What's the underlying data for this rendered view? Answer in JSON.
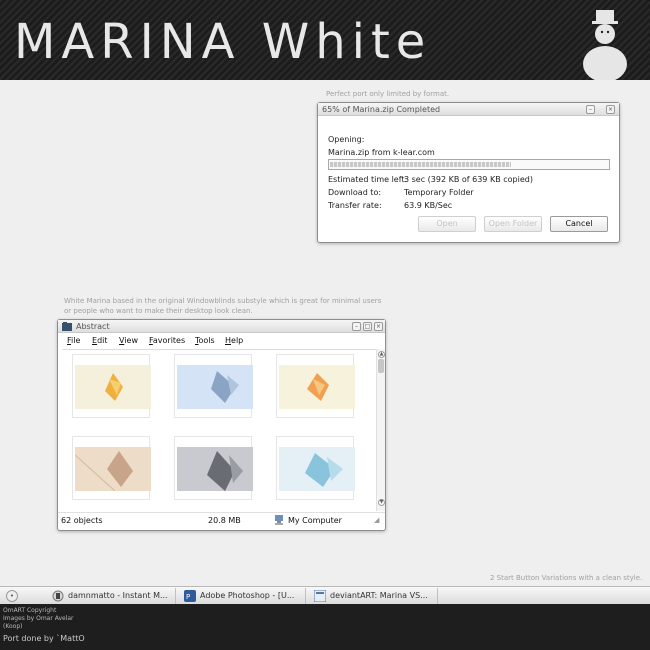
{
  "banner": {
    "title": "MARINA White"
  },
  "captions": {
    "top": "Perfect port only limited by format.",
    "middle": "White Marina based in the original Windowblinds substyle which is great for minimal users or people who want to make their desktop look clean.",
    "bottom": "2 Start Button Variations with a clean style."
  },
  "download_dialog": {
    "title": "65% of Marina.zip Completed",
    "opening_label": "Opening:",
    "file_source": "Marina.zip from k-lear.com",
    "progress_percent": 65,
    "rows": [
      {
        "label": "Estimated time left:",
        "value": "3 sec (392 KB of 639 KB copied)"
      },
      {
        "label": "Download to:",
        "value": "Temporary Folder"
      },
      {
        "label": "Transfer rate:",
        "value": "63.9 KB/Sec"
      }
    ],
    "buttons": {
      "open": "Open",
      "open_folder": "Open Folder",
      "cancel": "Cancel"
    }
  },
  "explorer": {
    "title": "Abstract",
    "menu": [
      "File",
      "Edit",
      "View",
      "Favorites",
      "Tools",
      "Help"
    ],
    "status": {
      "objects": "62 objects",
      "size": "20.8 MB",
      "location": "My Computer"
    }
  },
  "taskbar": {
    "start_icon": "start-orb-icon",
    "tasks": [
      {
        "label": "damnmatto - Instant M...",
        "icon": "chat-icon"
      },
      {
        "label": "Adobe Photoshop - [U...",
        "icon": "photoshop-icon"
      },
      {
        "label": "deviantART: Marina VS...",
        "icon": "browser-icon"
      }
    ]
  },
  "footer": {
    "lines": [
      "OmART Copyright",
      "Images by Omar Avelar",
      "(Koop)"
    ],
    "credit": "Port done by `MattO"
  },
  "colors": {
    "accent": "#2a2a2a",
    "desktop": "#efefef"
  }
}
